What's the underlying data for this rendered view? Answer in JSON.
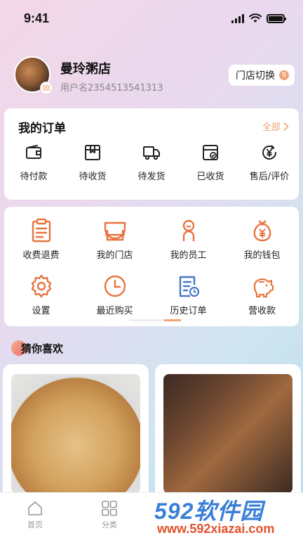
{
  "status_bar": {
    "time": "9:41"
  },
  "profile": {
    "shop_name": "曼玲粥店",
    "username": "用户名2354513541313",
    "switch_label": "门店切换"
  },
  "orders": {
    "title": "我的订单",
    "all_label": "全部",
    "items": [
      {
        "label": "待付款",
        "icon": "wallet-icon"
      },
      {
        "label": "待收货",
        "icon": "box-icon"
      },
      {
        "label": "待发货",
        "icon": "truck-icon"
      },
      {
        "label": "已收货",
        "icon": "received-icon"
      },
      {
        "label": "售后/评价",
        "icon": "yen-refund-icon"
      }
    ]
  },
  "tools": {
    "items": [
      {
        "label": "收费退费",
        "icon": "clipboard-icon"
      },
      {
        "label": "我的门店",
        "icon": "store-icon"
      },
      {
        "label": "我的员工",
        "icon": "staff-icon"
      },
      {
        "label": "我的钱包",
        "icon": "moneybag-icon"
      },
      {
        "label": "设置",
        "icon": "gear-icon"
      },
      {
        "label": "最近购买",
        "icon": "clock-icon"
      },
      {
        "label": "历史订单",
        "icon": "history-order-icon"
      },
      {
        "label": "营收款",
        "icon": "piggy-bank-icon"
      }
    ],
    "page_indicator": {
      "pages": 2,
      "current": 2
    }
  },
  "guess": {
    "title": "猜你喜欢"
  },
  "tabbar": {
    "items": [
      {
        "label": "首页",
        "icon": "home-icon"
      },
      {
        "label": "分类",
        "icon": "grid-icon"
      }
    ]
  },
  "watermark": {
    "top": "592软件园",
    "bottom": "www.592xiazai.com"
  },
  "colors": {
    "accent": "#e8733f",
    "accent_light": "#f1a37a",
    "tool_icon_blue": "#4a78c4"
  }
}
